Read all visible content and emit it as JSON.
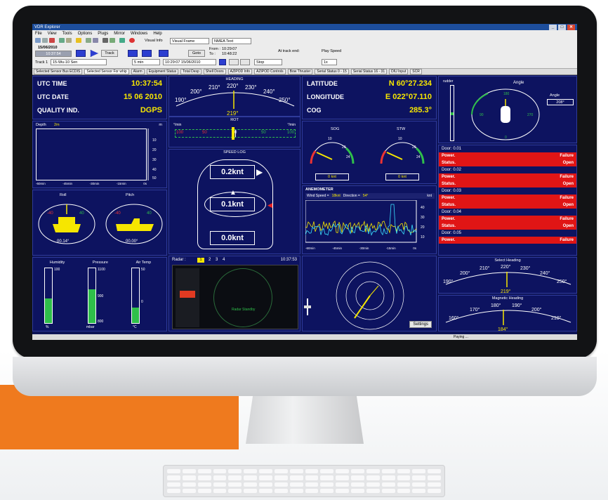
{
  "window": {
    "title": "VDR Explorer"
  },
  "menu": [
    "File",
    "View",
    "Tools",
    "Options",
    "Plugs",
    "Mirror",
    "Windows",
    "Help"
  ],
  "toolbar": {
    "date": "15/06/2010",
    "time": "10:37:54",
    "track_btn": "Track",
    "goto_btn": "Goto",
    "visual_info": "Visual Info",
    "visual_select": "Visual Frame",
    "nmea_select": "NMEA Text",
    "from_label": "From :",
    "from_value": "10:29:07",
    "to_label": "To :",
    "to_value": "10:48:22",
    "at_track_end": "At track end:",
    "stop": "Stop",
    "play_speed": "Play Speed",
    "play_speed_value": "1x",
    "track_label": "Track 1",
    "track_value": "15-Wu-10 Sen",
    "range": "5 min",
    "range_time": "10:29:07 15/06/2010"
  },
  "tabs": [
    "Selected Sensor Bus ECDIS",
    "Selected Sensor For whip",
    "Alarm",
    "Equipment Status",
    "Total Desp",
    "Shell Doors",
    "AZIPOD Info",
    "AZIPOD Controls",
    "Bow Thruster",
    "Serial Status 0 - 15",
    "Serial Status 16 - 31",
    "DIU Input",
    "SCR"
  ],
  "nav": {
    "utc_time_label": "UTC TIME",
    "utc_time": "10:37:54",
    "utc_date_label": "UTC DATE",
    "utc_date": "15 06 2010",
    "quality_label": "QUALITY IND.",
    "quality": "DGPS",
    "lat_label": "LATITUDE",
    "lat": "N 60°27.234",
    "lon_label": "LONGITUDE",
    "lon": "E 022°07.110",
    "cog_label": "COG",
    "cog": "285.3°"
  },
  "heading": {
    "title": "HEADING",
    "value": "219°",
    "ticks": [
      "190°",
      "200°",
      "210°",
      "220°",
      "230°",
      "240°",
      "250°"
    ]
  },
  "rot": {
    "title": "ROT",
    "left_cap": "°/min",
    "right_cap": "°/min",
    "ticks": [
      "100",
      "50",
      "0",
      "50",
      "100"
    ],
    "value": -5
  },
  "speed_log": {
    "title": "SPEED LOG",
    "top": "0.2knt",
    "mid": "0.1knt",
    "bottom": "0.0knt"
  },
  "sog": {
    "title": "SOG",
    "value": "0 knt",
    "ticks": [
      "0",
      "10",
      "20",
      "24"
    ]
  },
  "stw": {
    "title": "STW",
    "value": "0 knt",
    "ticks": [
      "0",
      "10",
      "20",
      "24"
    ]
  },
  "depth": {
    "title": "Depth",
    "unit": "m",
    "value": "2m",
    "ticks": [
      "10",
      "20",
      "30",
      "40",
      "50"
    ],
    "x_ticks": [
      "-60min",
      "-45min",
      "-30min",
      "-15min",
      "0s"
    ]
  },
  "roll": {
    "title": "Roll",
    "value": "00.14°",
    "port": "-40",
    "stbd": "40"
  },
  "pitch": {
    "title": "Pitch",
    "value": "00.00°",
    "port": "-40",
    "stbd": "40"
  },
  "bars": [
    {
      "title": "Humidity",
      "max": "100",
      "unit": "%",
      "fill": 0.45
    },
    {
      "title": "Pressure",
      "max": "1100",
      "mid": "900",
      "min": "800",
      "unit": "mbar",
      "fill": 0.62
    },
    {
      "title": "Air Temp",
      "max": "50",
      "mid": "0",
      "unit": "°C",
      "fill": 0.28
    }
  ],
  "radar": {
    "title": "Radar :",
    "channels": [
      "1",
      "2",
      "3",
      "4"
    ],
    "time": "10:37:53",
    "overlay": "Radar Standby"
  },
  "anemometer": {
    "title": "ANEMOMETER",
    "wind_speed_label": "Wind Speed =",
    "wind_speed": "18knt",
    "direction_label": "Direction =",
    "direction": "54°",
    "unit": "knt",
    "x_ticks": [
      "-60min",
      "-45min",
      "-30min",
      "-15min",
      "0s"
    ],
    "y_ticks": [
      "40",
      "30",
      "20",
      "10"
    ],
    "settings": "Settings"
  },
  "rudder": {
    "title": "rudder",
    "angle_label": "Angle",
    "angle_box": "Angle",
    "angle_value": "208°",
    "ticks": [
      "180",
      "90",
      "270",
      "0"
    ]
  },
  "doors": [
    {
      "name": "Door: 0.01",
      "power": "Power.",
      "power_state": "Failure",
      "status": "Status.",
      "status_state": "Open"
    },
    {
      "name": "Door: 0.02",
      "power": "Power.",
      "power_state": "Failure",
      "status": "Status.",
      "status_state": "Open"
    },
    {
      "name": "Door: 0.03",
      "power": "Power.",
      "power_state": "Failure",
      "status": "Status.",
      "status_state": "Open"
    },
    {
      "name": "Door: 0.04",
      "power": "Power.",
      "power_state": "Failure",
      "status": "Status.",
      "status_state": "Open"
    },
    {
      "name": "Door: 0.05",
      "power": "Power.",
      "power_state": "Failure"
    }
  ],
  "select_heading": {
    "title": "Select Heading",
    "value": "219°",
    "ticks": [
      "190°",
      "200°",
      "210°",
      "220°",
      "230°",
      "240°",
      "250°"
    ]
  },
  "magnetic_heading": {
    "title": "Magnetic Heading",
    "value": "184°",
    "ticks": [
      "160°",
      "170°",
      "180°",
      "190°",
      "200°",
      "210°"
    ]
  },
  "statusbar": {
    "text": "Paying ..."
  },
  "colors": {
    "screen_bg": "#0d1360",
    "value_yellow": "#f6e600",
    "alarm_red": "#e01515",
    "accent_orange": "#ef7a1e",
    "gauge_green": "#2fbf4a"
  }
}
